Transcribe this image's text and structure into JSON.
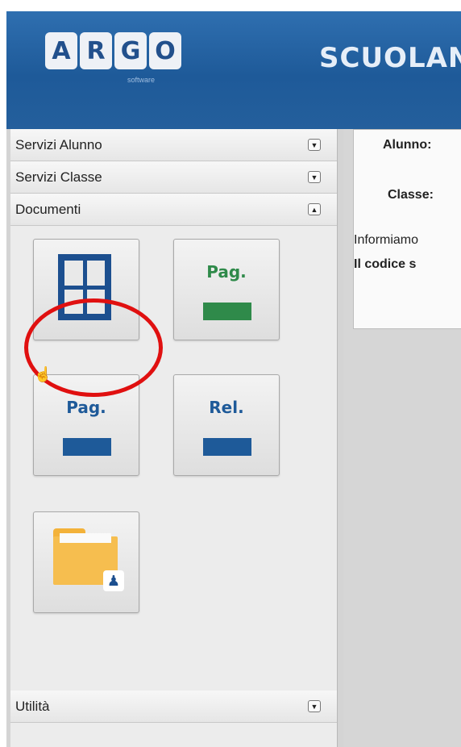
{
  "header": {
    "logo_letters": [
      "A",
      "R",
      "G",
      "O"
    ],
    "logo_subtitle": "software",
    "app_title": "SCUOLANE"
  },
  "sidebar": {
    "sections": [
      {
        "label": "Servizi Alunno",
        "toggle": "collapsed"
      },
      {
        "label": "Servizi Classe",
        "toggle": "collapsed"
      },
      {
        "label": "Documenti",
        "toggle": "expanded"
      }
    ],
    "documents": [
      {
        "icon": "grid-icon",
        "label": ""
      },
      {
        "icon": "page-icon",
        "label": "Pag.",
        "color": "#2f8a4a"
      },
      {
        "icon": "page-icon",
        "label": "Pag.",
        "color": "#1e5a99"
      },
      {
        "icon": "report-icon",
        "label": "Rel.",
        "color": "#1e5a99"
      },
      {
        "icon": "folder-person-icon",
        "label": ""
      }
    ],
    "bottom_section": {
      "label": "Utilità",
      "toggle": "collapsed"
    }
  },
  "main": {
    "alunno_label": "Alunno:",
    "classe_label": "Classe:",
    "info_line": "Informiamo",
    "code_line": "Il codice s"
  },
  "colors": {
    "accent": "#1e5a99",
    "highlight": "#e01010",
    "green_bar": "#2f8a4a"
  }
}
